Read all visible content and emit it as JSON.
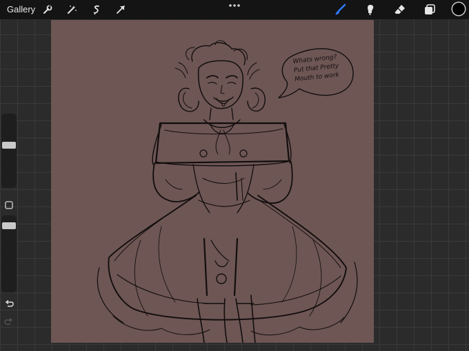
{
  "toolbar": {
    "gallery_label": "Gallery",
    "left_tools": [
      "wrench-icon",
      "magic-wand-icon",
      "selection-icon",
      "transform-icon"
    ],
    "right_tools": [
      "brush-icon",
      "smudge-icon",
      "eraser-icon",
      "layers-icon"
    ],
    "active_tool": "brush-icon",
    "accent_color": "#2e7bff",
    "current_color": "#000000"
  },
  "canvas": {
    "background_color": "#6d5654",
    "speech_bubble_lines": [
      "Whats wrong?",
      "Put that Pretty",
      "Mouth to work"
    ]
  },
  "sidebar": {
    "brush_size_level": 0.3,
    "opacity_level": 0.6,
    "icons": [
      "modify-square-icon",
      "undo-icon",
      "redo-icon"
    ]
  }
}
